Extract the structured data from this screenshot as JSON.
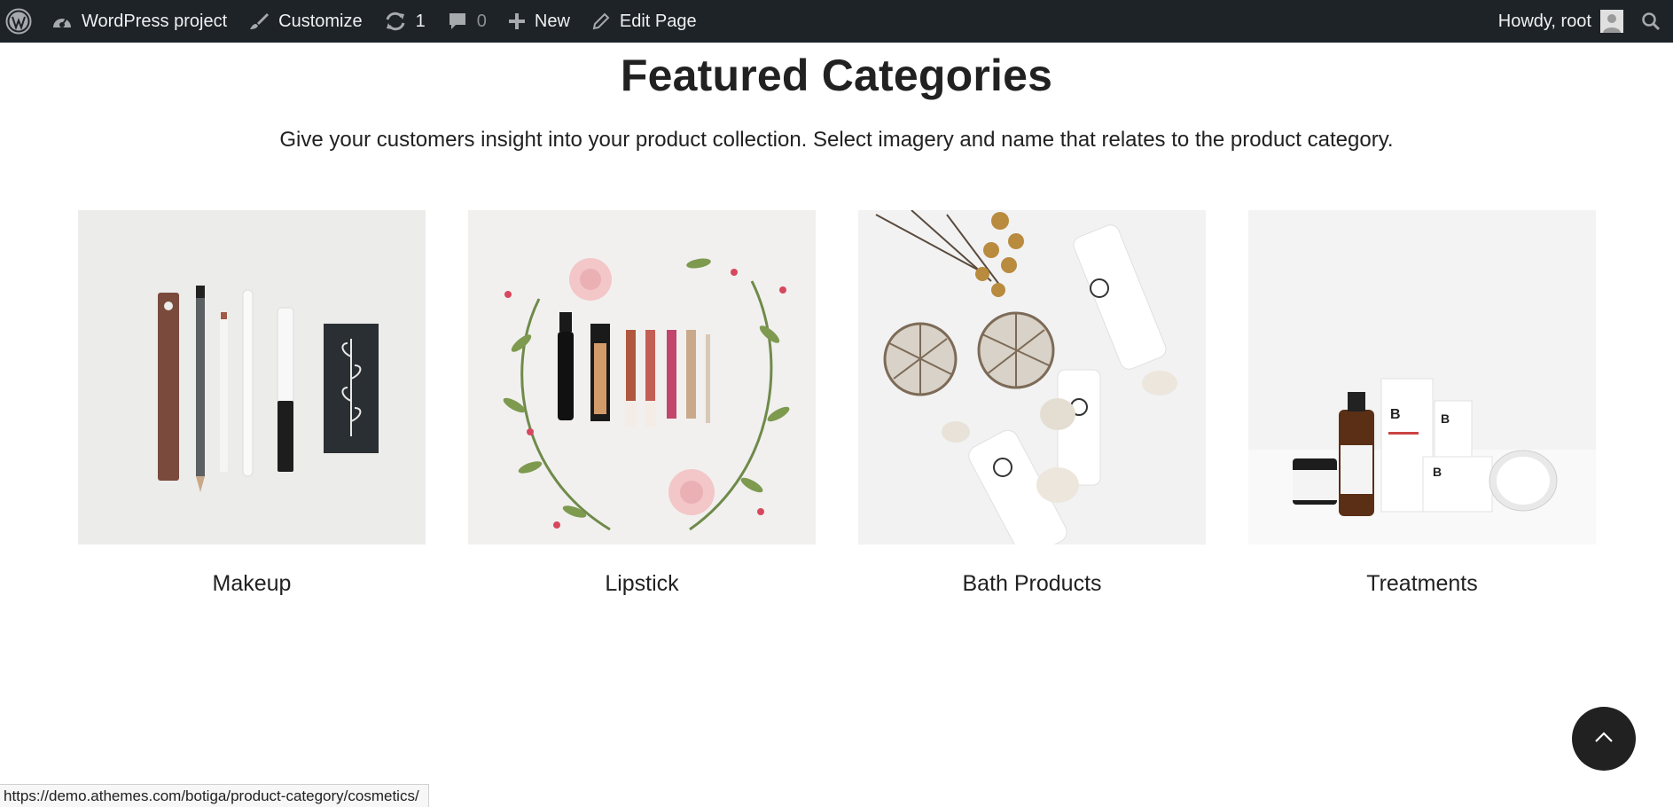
{
  "adminbar": {
    "wp_logo": "wordpress-icon",
    "site_name": "WordPress project",
    "customize": "Customize",
    "updates_count": "1",
    "comments_count": "0",
    "new": "New",
    "edit_page": "Edit Page",
    "howdy": "Howdy, root"
  },
  "section": {
    "title": "Featured Categories",
    "subtitle": "Give your customers insight into your product collection. Select imagery and name that relates to the product category."
  },
  "categories": [
    {
      "label": "Makeup"
    },
    {
      "label": "Lipstick"
    },
    {
      "label": "Bath Products"
    },
    {
      "label": "Treatments"
    }
  ],
  "status_url": "https://demo.athemes.com/botiga/product-category/cosmetics/",
  "colors": {
    "adminbar_bg": "#1d2327",
    "text": "#212121",
    "totop_bg": "#212121"
  }
}
